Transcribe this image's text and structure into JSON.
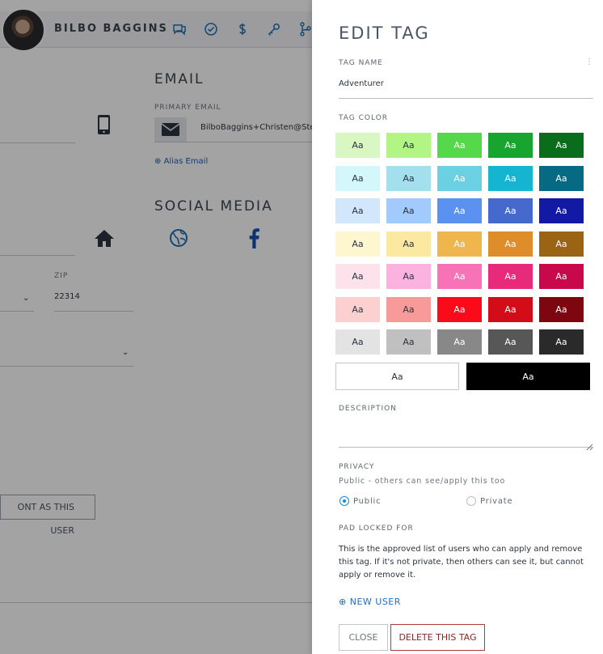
{
  "background": {
    "user_name": "BILBO BAGGINS",
    "email_heading": "EMAIL",
    "primary_email_label": "PRIMARY EMAIL",
    "primary_email_value": "BilboBaggins+Christen@Ste",
    "alias_email_link": "Alias Email",
    "social_media_heading": "SOCIAL MEDIA",
    "zip_label": "ZIP",
    "zip_value": "22314",
    "act_as_user_button": "ONT AS THIS USER"
  },
  "drawer": {
    "title": "EDIT TAG",
    "tag_name_label": "TAG NAME",
    "tag_name_value": "Adventurer",
    "tag_color_label": "TAG COLOR",
    "swatch_text": "Aa",
    "swatch_rows": [
      [
        {
          "bg": "#d8f7c2",
          "fg": "#2c3440"
        },
        {
          "bg": "#b2f584",
          "fg": "#2c3440"
        },
        {
          "bg": "#55d84a",
          "fg": "#ffffff"
        },
        {
          "bg": "#17a52f",
          "fg": "#ffffff"
        },
        {
          "bg": "#0a6d1c",
          "fg": "#ffffff"
        }
      ],
      [
        {
          "bg": "#d4f7fb",
          "fg": "#2c3440"
        },
        {
          "bg": "#a3dfec",
          "fg": "#2c3440"
        },
        {
          "bg": "#6bd0e1",
          "fg": "#ffffff"
        },
        {
          "bg": "#15b4d1",
          "fg": "#ffffff"
        },
        {
          "bg": "#066a84",
          "fg": "#ffffff"
        }
      ],
      [
        {
          "bg": "#d2e7fb",
          "fg": "#2c3440"
        },
        {
          "bg": "#a2cafc",
          "fg": "#2c3440"
        },
        {
          "bg": "#5b91f0",
          "fg": "#ffffff"
        },
        {
          "bg": "#4569cc",
          "fg": "#ffffff"
        },
        {
          "bg": "#1219a5",
          "fg": "#ffffff"
        }
      ],
      [
        {
          "bg": "#fdf6cf",
          "fg": "#2c3440"
        },
        {
          "bg": "#fbe8a1",
          "fg": "#2c3440"
        },
        {
          "bg": "#efb64e",
          "fg": "#ffffff"
        },
        {
          "bg": "#de8d2a",
          "fg": "#ffffff"
        },
        {
          "bg": "#9a6414",
          "fg": "#ffffff"
        }
      ],
      [
        {
          "bg": "#fde2ec",
          "fg": "#2c3440"
        },
        {
          "bg": "#fbb2de",
          "fg": "#2c3440"
        },
        {
          "bg": "#f872b7",
          "fg": "#ffffff"
        },
        {
          "bg": "#e82a7b",
          "fg": "#ffffff"
        },
        {
          "bg": "#c8084a",
          "fg": "#ffffff"
        }
      ],
      [
        {
          "bg": "#fdd0d0",
          "fg": "#2c3440"
        },
        {
          "bg": "#f89a9a",
          "fg": "#2c3440"
        },
        {
          "bg": "#fb0b1a",
          "fg": "#ffffff"
        },
        {
          "bg": "#d20d18",
          "fg": "#ffffff"
        },
        {
          "bg": "#7e0610",
          "fg": "#ffffff"
        }
      ],
      [
        {
          "bg": "#e3e3e3",
          "fg": "#2c3440"
        },
        {
          "bg": "#c0c0c0",
          "fg": "#2c3440"
        },
        {
          "bg": "#888888",
          "fg": "#ffffff"
        },
        {
          "bg": "#575757",
          "fg": "#ffffff"
        },
        {
          "bg": "#2a2a2a",
          "fg": "#ffffff"
        }
      ]
    ],
    "wide_swatches": [
      {
        "bg": "#ffffff",
        "fg": "#2c3440",
        "border": "#c3c7cc"
      },
      {
        "bg": "#000000",
        "fg": "#ffffff",
        "border": "#000000"
      }
    ],
    "description_label": "DESCRIPTION",
    "privacy_label": "PRIVACY",
    "privacy_hint": "Public - others can see/apply this too",
    "privacy_public": "Public",
    "privacy_private": "Private",
    "pad_locked_label": "PAD LOCKED FOR",
    "pad_locked_text": "This is the approved list of users who can apply and remove this tag. If it's not private, then others can see it, but cannot apply or remove it.",
    "new_user_link": "NEW USER",
    "close_button": "CLOSE",
    "delete_button": "DELETE THIS TAG"
  },
  "icons": {
    "top_bar": [
      "chat-icon",
      "check-circle-icon",
      "dollar-icon",
      "key-icon",
      "branch-icon"
    ],
    "phone": "phone-icon",
    "mail": "envelope-icon",
    "social": [
      "home-icon",
      "globe-icon",
      "facebook-icon"
    ]
  },
  "colors": {
    "accent_blue": "#1b86e3",
    "danger": "#8b2626"
  }
}
